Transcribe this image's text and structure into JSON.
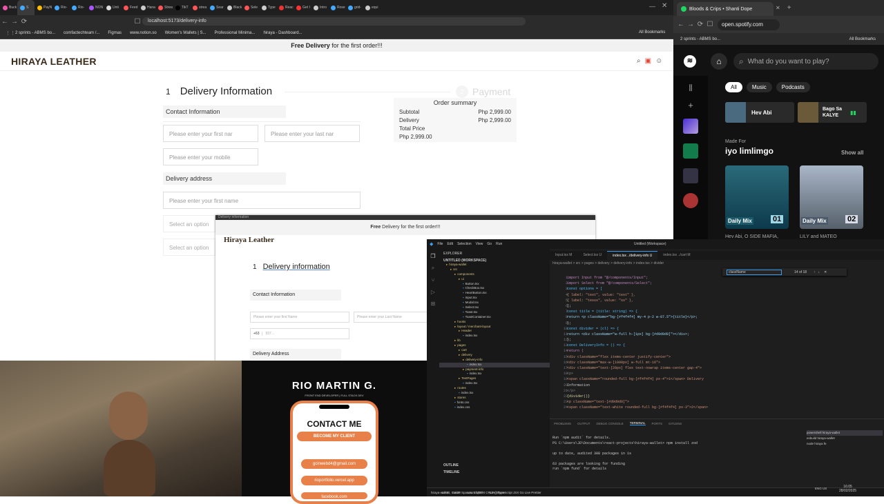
{
  "left_browser": {
    "tabs": [
      "Buck",
      "S",
      "PayN",
      "Rio-",
      "Rio-",
      "NON",
      "Unti",
      "Feed",
      "Hana",
      "Strea",
      "TikT",
      "strea",
      "Sear",
      "Black",
      "Sele",
      "Type",
      "Reac",
      "Get I",
      "Intro",
      "Rose",
      "grid-",
      "equi"
    ],
    "active_tab": "S",
    "url": "localhost:5173/delivery-info",
    "bookmarks": [
      "2 sprints - ABMS bo...",
      "comfactechteam /...",
      "Figmas",
      "www.notion.so",
      "Women's Wallets | S...",
      "Professional Minima...",
      "hiraya - Dashboard..."
    ],
    "all_bookmarks": "All Bookmarks"
  },
  "page": {
    "promo_bold": "Free Delivery",
    "promo_rest": " for the first order!!!",
    "brand": "HIRAYA LEATHER",
    "step1_num": "1",
    "step1_label": "Delivery Information",
    "step2_num": "2",
    "step2_label": "Payment",
    "contact_section": "Contact Information",
    "first_name_ph": "Please enter your first nar",
    "last_name_ph": "Please enter your last nar",
    "mobile_ph": "Please enter your mobile",
    "address_section": "Delivery address",
    "address_ph": "Please enter your first name",
    "select1": "Select an option",
    "select2": "Select an option",
    "summary": {
      "title": "Order summary",
      "subtotal_label": "Subtotal",
      "subtotal": "Php 2,999.00",
      "delivery_label": "Delivery",
      "delivery": "Php 2,999.00",
      "total_label": "Total Price",
      "total": "Php 2,999.00"
    }
  },
  "overlay": {
    "title": "Delivery information",
    "promo_bold": "Free",
    "promo_rest": " Delivery for the first order!!!",
    "brand": "Hiraya Leather",
    "step_num": "1",
    "step_label": "Delivery information",
    "contact": "Contact Information",
    "first_ph": "Please enter your first Name",
    "last_ph": "Please enter your Last Name",
    "code": "+63",
    "mobile_ph": "937...",
    "address": "Delivery Address"
  },
  "spotify": {
    "tab_title": "Bloods & Crips • Shanti Dope",
    "url": "open.spotify.com",
    "bookmark": "2 sprints - ABMS bo...",
    "all_bookmarks": "All Bookmarks",
    "search_ph": "What do you want to play?",
    "filters": [
      "All",
      "Music",
      "Podcasts"
    ],
    "recent": [
      {
        "label": "Hev Abi"
      },
      {
        "label": "Bago Sa KALYE"
      }
    ],
    "made_for": "Made For",
    "user": "iyo limlimgo",
    "show_all": "Show all",
    "mixes": [
      {
        "name": "Daily Mix",
        "num": "01",
        "caption": "Hev Abi, O SIDE MAFIA,"
      },
      {
        "name": "Daily Mix",
        "num": "02",
        "caption": "LILY and MATEO"
      }
    ]
  },
  "vscode": {
    "menu": [
      "File",
      "Edit",
      "Selection",
      "View",
      "Go",
      "Run"
    ],
    "title": "Untitled (Workspace)",
    "explorer_title": "EXPLORER",
    "workspace": "UNTITLED (WORKSPACE)",
    "tree": [
      "hiraya-wallet",
      "src",
      "components",
      "ui",
      "Button.tsx",
      "CheckBox.tsx",
      "HeartButton.tsx",
      "Input.tsx",
      "Modal.tsx",
      "Select.tsx",
      "Toast.tsx",
      "ToastContainer.tsx",
      "hooks",
      "layout / merchant-layout",
      "Header",
      "index.tsx",
      "lib",
      "pages",
      "cart",
      "delivery",
      "delivery-info",
      "index.tsx",
      "payment-info",
      "index.tsx",
      "TestPages",
      "index.tsx",
      "routes",
      "index.tsx",
      "stores",
      "fonts.css",
      "index.css"
    ],
    "outline": "OUTLINE",
    "timeline": "TIMELINE",
    "editor_tabs": [
      "Input.tsx M",
      "Select.tsx U",
      "index.tsx ../delivery-info U",
      "index.tsx ../cart M"
    ],
    "breadcrumb": "hiraya-wallet > src > pages > delivery > delivery-info > index.tsx > divider",
    "find": "className",
    "find_count": "14 of 18",
    "line_numbers": [
      "1",
      "2",
      "3",
      "4",
      "5",
      "6",
      "7",
      "8",
      "9",
      "10",
      "11",
      "12",
      "13",
      "14",
      "15",
      "16",
      "17",
      "18",
      "19",
      "20",
      "21",
      "22",
      "23",
      "24"
    ],
    "code": [
      "import Input from \"@/components/Input\";",
      "import Select from \"@/components/Select\";",
      "const options = [",
      "  { label: \"test\", value: \"test\" },",
      "  { label: \"tesss\", value: \"ss\" },",
      "];",
      "const title = (title: string) => {",
      "  return <p className=\"bg-[#f4f4f4] my-4 p-2 w-87.5\">{title}</p>;",
      "};",
      "const divider = (cl) => {",
      "  return <div className=\"w-full h-[1px] bg-[#d9d9d9]\"></div>;",
      "};",
      "const DeliveryInfo = () => {",
      "  return (",
      "    <div className=\"flex items-center justify-center\">",
      "      <div className=\"max-w-[1000px] w-full mt-16\">",
      "        <div className=\"text-[20px] flex text-nowrap items-center gap-4\">",
      "          <p>",
      "            <span className=\"rounded-full bg-[#f4f4f4] px-4\">1</span> Delivery",
      "            Information",
      "          </p>",
      "          {divider()}",
      "          <p className=\"text-[#d9d9d9]\">",
      "            <span className=\"text-white rounded-full bg-[#f4f4f4] px-3\">2</span>"
    ],
    "panel_tabs": [
      "PROBLEMS",
      "OUTPUT",
      "DEBUG CONSOLE",
      "TERMINAL",
      "PORTS",
      "GITLENS"
    ],
    "terminal": [
      "Run `npm audit` for details.",
      "PS C:\\Users\\JD\\Documents\\react-projects\\hiraya-wallet> npm install zod",
      "",
      "up to date, audited 308 packages in 1s",
      "",
      "63 packages are looking for funding",
      "  run `npm fund` for details"
    ],
    "terminals": [
      "powershell hiraya-wallet",
      "esbuild hiraya-wallet",
      "node hiraya fe"
    ],
    "status_left": "hiraya-wallet",
    "status_branch": "main*",
    "status_right": "Ln 10, Col 28   Spaces: 2   UTF-8   CRLF   {} TypeScript JSX   Go Live   Prettier",
    "launchpad": "Launchpad",
    "live_share": "Live Share",
    "clock": "16:05",
    "date": "28/02/2025",
    "lang": "ENG US"
  },
  "card": {
    "name": "RIO MARTIN G.",
    "subtitle": "FRONT END DEVELOPER | FULL STACK DEV",
    "contact_heading": "CONTACT ME",
    "cta": "BECOME MY CLIENT",
    "links": [
      "gcinwebd4@gmail.com",
      "rioportfolio.vercel.app",
      "facebook.com"
    ]
  }
}
